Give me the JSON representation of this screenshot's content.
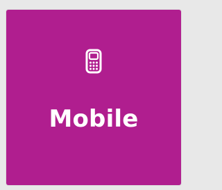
{
  "tile": {
    "label": "Mobile",
    "icon": "mobile-phone-icon",
    "background_color": "#b01e8f",
    "text_color": "#ffffff"
  },
  "page": {
    "background_color": "#e8e8e8"
  }
}
